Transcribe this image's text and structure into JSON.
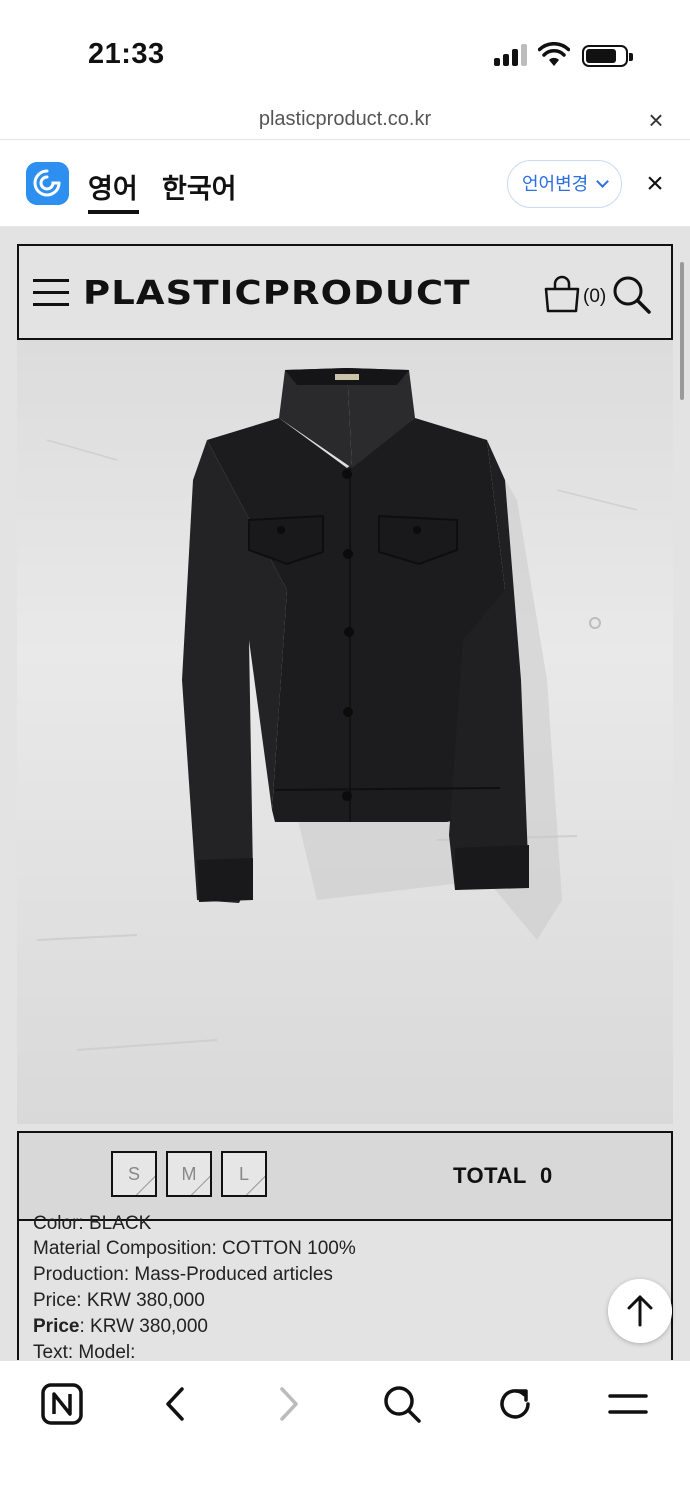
{
  "status": {
    "time": "21:33"
  },
  "browser": {
    "url": "plasticproduct.co.kr",
    "close_glyph": "×"
  },
  "translate": {
    "tab_active": "영어",
    "tab_other": "한국어",
    "change_button": "언어변경",
    "close_glyph": "×"
  },
  "site": {
    "brand": "PLASTICPRODUCT",
    "cart_count": "(0)"
  },
  "product": {
    "sizes": [
      "S",
      "M",
      "L"
    ],
    "total_label": "TOTAL",
    "total_value": "0",
    "details": {
      "color_line": "Color: BLACK",
      "material_line": "Material Composition: COTTON 100%",
      "production_line": "Production: Mass-Produced articles",
      "price_line": "Price: KRW 380,000",
      "price_bold_label": "Price",
      "price_bold_value": ": KRW 380,000",
      "text_line": "Text: Model:"
    }
  },
  "icons": {
    "papago": "papago-translate-icon",
    "menu": "hamburger-menu-icon",
    "cart": "shopping-bag-icon",
    "search": "search-icon",
    "scroll_top": "arrow-up-icon",
    "home": "naver-n-icon",
    "back": "chevron-left-icon",
    "forward": "chevron-right-icon",
    "find": "search-icon",
    "reload": "reload-icon",
    "more": "menu-icon"
  },
  "colors": {
    "accent_blue": "#2d6fe0",
    "papago_blue": "#2d8ff0",
    "page_bg": "#e3e3e3",
    "jacket": "#1c1c1e"
  }
}
